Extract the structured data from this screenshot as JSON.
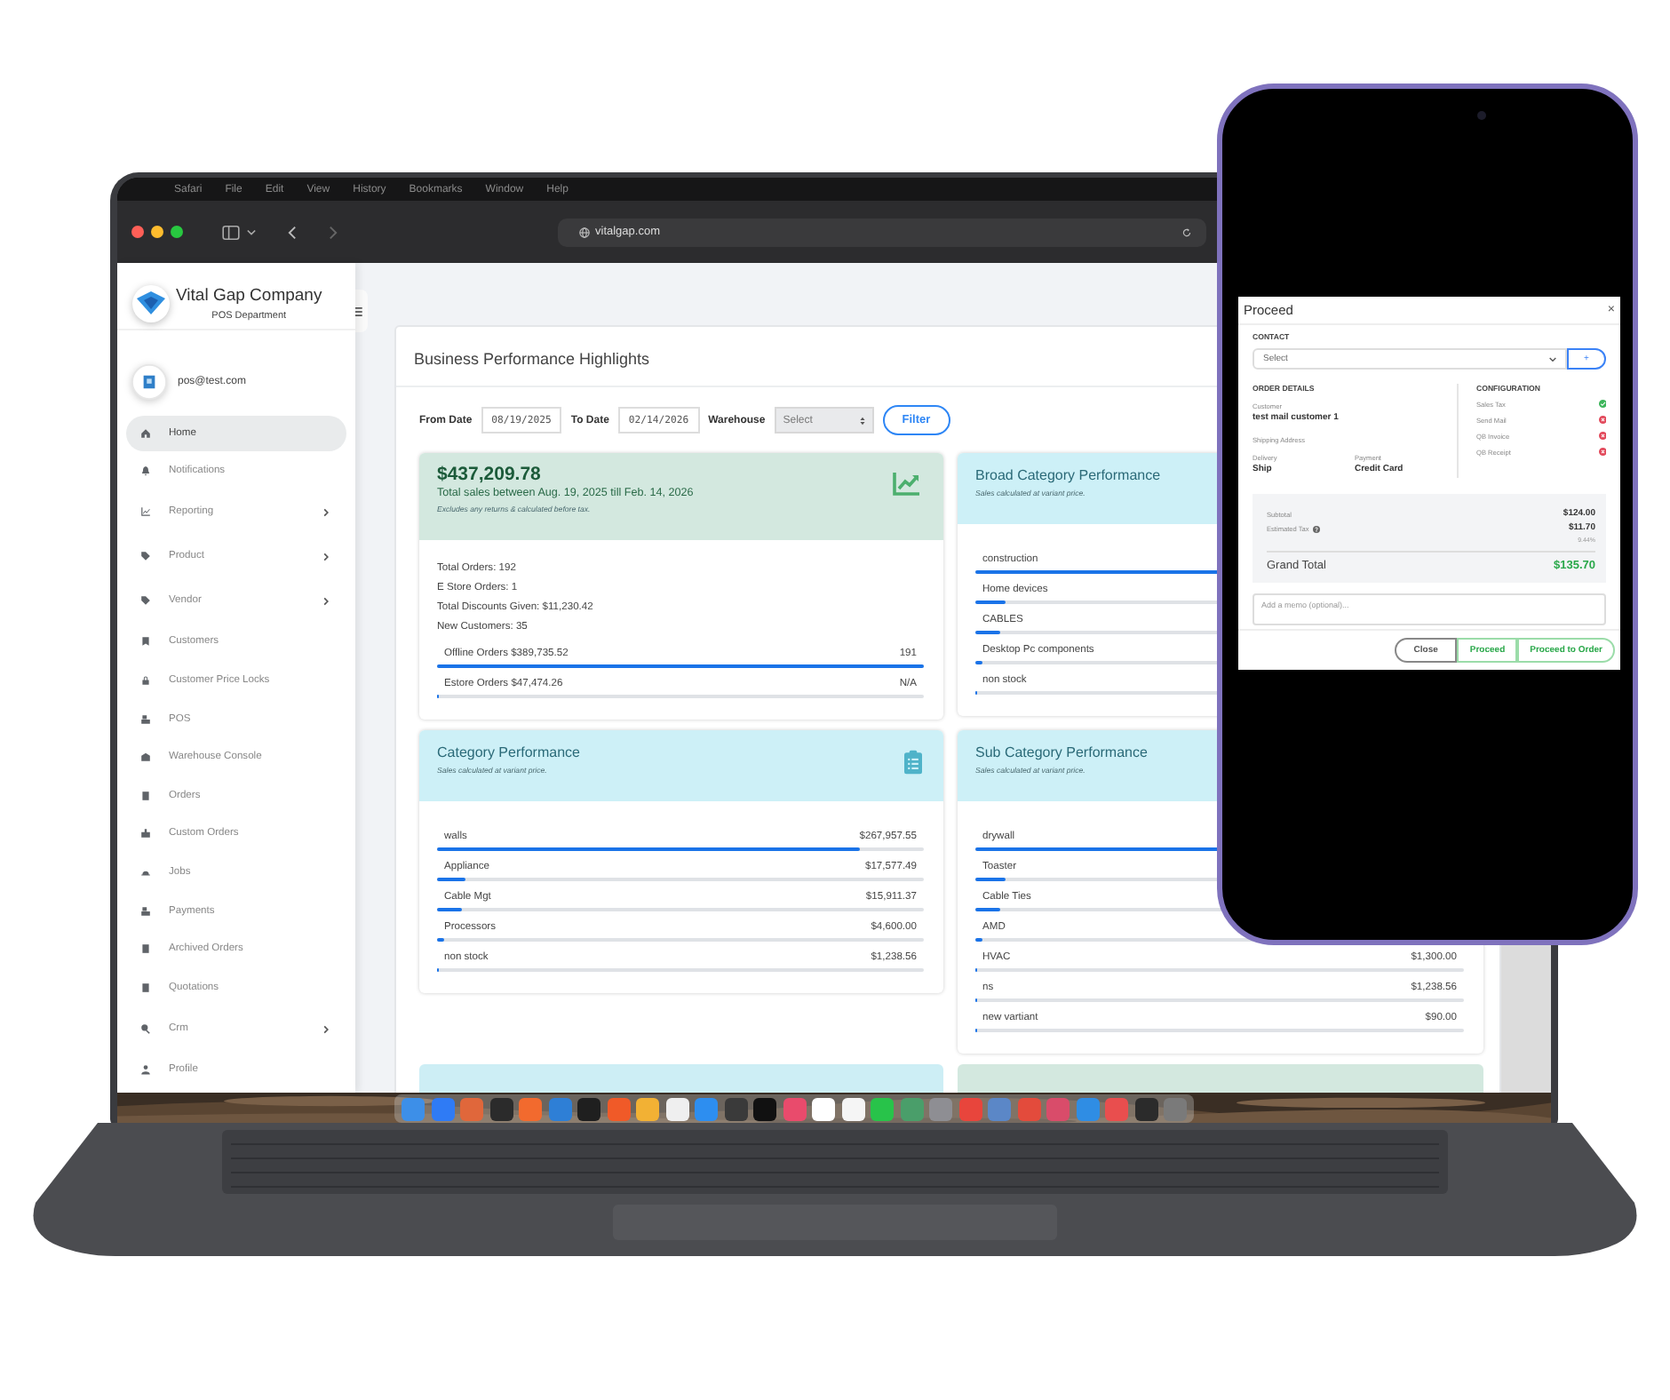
{
  "mac_menu": [
    "Safari",
    "File",
    "Edit",
    "View",
    "History",
    "Bookmarks",
    "Window",
    "Help"
  ],
  "browser": {
    "url": "vitalgap.com"
  },
  "sidebar": {
    "company": "Vital Gap Company",
    "department": "POS Department",
    "user": "pos@test.com",
    "items": [
      {
        "label": "Home",
        "selected": true,
        "submenu": false
      },
      {
        "label": "Notifications",
        "selected": false,
        "submenu": false
      },
      {
        "label": "Reporting",
        "selected": false,
        "submenu": true
      },
      {
        "label": "Product",
        "selected": false,
        "submenu": true
      },
      {
        "label": "Vendor",
        "selected": false,
        "submenu": true
      },
      {
        "label": "Customers",
        "selected": false,
        "submenu": false
      },
      {
        "label": "Customer Price Locks",
        "selected": false,
        "submenu": false
      },
      {
        "label": "POS",
        "selected": false,
        "submenu": false
      },
      {
        "label": "Warehouse Console",
        "selected": false,
        "submenu": false
      },
      {
        "label": "Orders",
        "selected": false,
        "submenu": false
      },
      {
        "label": "Custom Orders",
        "selected": false,
        "submenu": false
      },
      {
        "label": "Jobs",
        "selected": false,
        "submenu": false
      },
      {
        "label": "Payments",
        "selected": false,
        "submenu": false
      },
      {
        "label": "Archived Orders",
        "selected": false,
        "submenu": false
      },
      {
        "label": "Quotations",
        "selected": false,
        "submenu": false
      },
      {
        "label": "Crm",
        "selected": false,
        "submenu": true
      },
      {
        "label": "Profile",
        "selected": false,
        "submenu": false
      }
    ]
  },
  "dashboard": {
    "title": "Business Performance Highlights",
    "filters": {
      "from_label": "From Date",
      "from_value": "08/19/2025",
      "to_label": "To Date",
      "to_value": "02/14/2026",
      "warehouse_label": "Warehouse",
      "warehouse_placeholder": "Select",
      "button": "Filter"
    },
    "cards": [
      {
        "kind": "sales",
        "total": "$437,209.78",
        "subtitle": "Total sales between Aug. 19, 2025 till Feb. 14, 2026",
        "note": "Excludes any returns & calculated before tax.",
        "stats": [
          "Total Orders: 192",
          "E Store Orders: 1",
          "Total Discounts Given: $11,230.42",
          "New Customers: 35"
        ],
        "rows": [
          {
            "label": "Offline Orders $389,735.52",
            "value": "191",
            "level": 1
          },
          {
            "label": "Estore Orders $47,474.26",
            "value": "N/A",
            "level": 0.005
          }
        ]
      },
      {
        "kind": "category",
        "title": "Broad Category Performance",
        "subtitle": "Sales calculated at variant price.",
        "rows": [
          {
            "label": "construction",
            "level": 0.9
          },
          {
            "label": "Home devices",
            "level": 0.06
          },
          {
            "label": "CABLES",
            "level": 0.05
          },
          {
            "label": "Desktop Pc components",
            "level": 0.015
          },
          {
            "label": "non stock",
            "level": 0.004
          }
        ]
      },
      {
        "kind": "category",
        "title": "Category Performance",
        "subtitle": "Sales calculated at variant price.",
        "header_icon": true,
        "rows": [
          {
            "label": "walls",
            "value": "$267,957.55",
            "level": 0.87
          },
          {
            "label": "Appliance",
            "value": "$17,577.49",
            "level": 0.057
          },
          {
            "label": "Cable Mgt",
            "value": "$15,911.37",
            "level": 0.051
          },
          {
            "label": "Processors",
            "value": "$4,600.00",
            "level": 0.015
          },
          {
            "label": "non stock",
            "value": "$1,238.56",
            "level": 0.004
          }
        ]
      },
      {
        "kind": "category",
        "title": "Sub Category Performance",
        "subtitle": "Sales calculated at variant price.",
        "rows": [
          {
            "label": "drywall",
            "level": 0.8
          },
          {
            "label": "Toaster",
            "level": 0.06
          },
          {
            "label": "Cable Ties",
            "level": 0.05
          },
          {
            "label": "AMD",
            "level": 0.015
          },
          {
            "label": "HVAC",
            "value": "$1,300.00",
            "level": 0.004
          },
          {
            "label": "ns",
            "value": "$1,238.56",
            "level": 0.004
          },
          {
            "label": "new vartiant",
            "value": "$90.00",
            "level": 0.001
          }
        ]
      },
      {
        "kind": "stub",
        "color": "#cdeef5"
      },
      {
        "kind": "stub",
        "color": "#d3e8df"
      }
    ]
  },
  "phone": {
    "modal": {
      "title": "Proceed",
      "close": "×",
      "contact_label": "CONTACT",
      "contact_placeholder": "Select",
      "add_button": "+",
      "order_details_label": "ORDER DETAILS",
      "customer_label": "Customer",
      "customer": "test mail customer 1",
      "shipping_label": "Shipping Address",
      "delivery_label": "Delivery",
      "delivery": "Ship",
      "payment_label": "Payment",
      "payment": "Credit Card",
      "configuration_label": "CONFIGURATION",
      "configuration": [
        {
          "label": "Sales Tax",
          "on": true
        },
        {
          "label": "Send Mail",
          "on": false
        },
        {
          "label": "QB Invoice",
          "on": false
        },
        {
          "label": "QB Receipt",
          "on": false
        }
      ],
      "subtotal_label": "Subtotal",
      "subtotal": "$124.00",
      "tax_label": "Estimated Tax",
      "tax": "$11.70",
      "tax_rate": "9.44%",
      "grand_total_label": "Grand Total",
      "grand_total": "$135.70",
      "memo_placeholder": "Add a memo (optional)...",
      "buttons": [
        {
          "label": "Close",
          "kind": "plain"
        },
        {
          "label": "Proceed",
          "kind": "success"
        },
        {
          "label": "Proceed to Order",
          "kind": "success"
        }
      ]
    }
  }
}
